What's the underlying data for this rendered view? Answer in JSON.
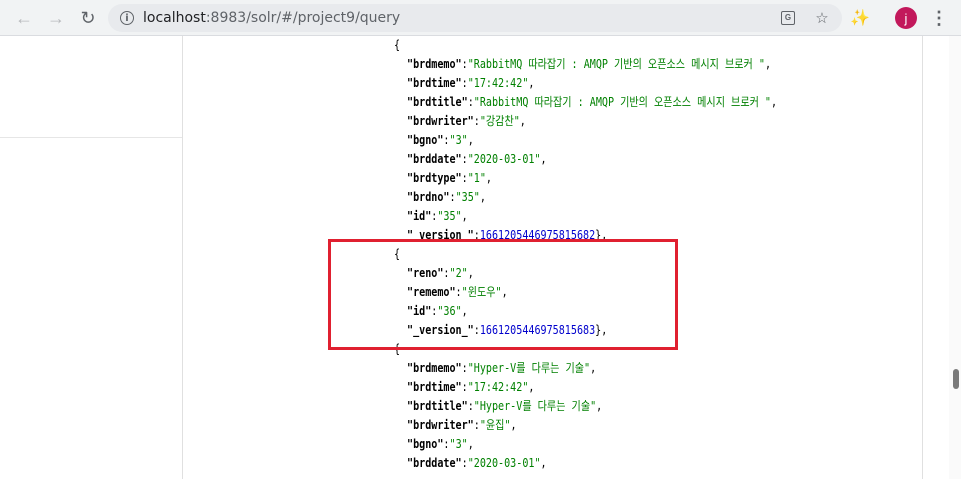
{
  "browser": {
    "url_host": "localhost",
    "url_rest": ":8983/solr/#/project9/query",
    "avatar_letter": "j"
  },
  "records": [
    {
      "type": "brace",
      "text": "{"
    },
    {
      "type": "kv",
      "key": "\"brdmemo\"",
      "value": "\"RabbitMQ 따라잡기 : AMQP 기반의 오픈소스 메시지 브로커 \"",
      "vtype": "s",
      "tail": ","
    },
    {
      "type": "kv",
      "key": "\"brdtime\"",
      "value": "\"17:42:42\"",
      "vtype": "s",
      "tail": ","
    },
    {
      "type": "kv",
      "key": "\"brdtitle\"",
      "value": "\"RabbitMQ 따라잡기 : AMQP 기반의 오픈소스 메시지 브로커 \"",
      "vtype": "s",
      "tail": ","
    },
    {
      "type": "kv",
      "key": "\"brdwriter\"",
      "value": "\"강감찬\"",
      "vtype": "s",
      "tail": ","
    },
    {
      "type": "kv",
      "key": "\"bgno\"",
      "value": "\"3\"",
      "vtype": "s",
      "tail": ","
    },
    {
      "type": "kv",
      "key": "\"brddate\"",
      "value": "\"2020-03-01\"",
      "vtype": "s",
      "tail": ","
    },
    {
      "type": "kv",
      "key": "\"brdtype\"",
      "value": "\"1\"",
      "vtype": "s",
      "tail": ","
    },
    {
      "type": "kv",
      "key": "\"brdno\"",
      "value": "\"35\"",
      "vtype": "s",
      "tail": ","
    },
    {
      "type": "kv",
      "key": "\"id\"",
      "value": "\"35\"",
      "vtype": "s",
      "tail": ","
    },
    {
      "type": "kv",
      "key": "\"_version_\"",
      "value": "1661205446975815682",
      "vtype": "n",
      "tail": "},"
    },
    {
      "type": "brace",
      "text": "{"
    },
    {
      "type": "kv",
      "key": "\"reno\"",
      "value": "\"2\"",
      "vtype": "s",
      "tail": ","
    },
    {
      "type": "kv",
      "key": "\"rememo\"",
      "value": "\"윈도우\"",
      "vtype": "s",
      "tail": ","
    },
    {
      "type": "kv",
      "key": "\"id\"",
      "value": "\"36\"",
      "vtype": "s",
      "tail": ","
    },
    {
      "type": "kv",
      "key": "\"_version_\"",
      "value": "1661205446975815683",
      "vtype": "n",
      "tail": "},"
    },
    {
      "type": "brace",
      "text": "{"
    },
    {
      "type": "kv",
      "key": "\"brdmemo\"",
      "value": "\"Hyper-V를 다루는 기술\"",
      "vtype": "s",
      "tail": ","
    },
    {
      "type": "kv",
      "key": "\"brdtime\"",
      "value": "\"17:42:42\"",
      "vtype": "s",
      "tail": ","
    },
    {
      "type": "kv",
      "key": "\"brdtitle\"",
      "value": "\"Hyper-V를 다루는 기술\"",
      "vtype": "s",
      "tail": ","
    },
    {
      "type": "kv",
      "key": "\"brdwriter\"",
      "value": "\"윤집\"",
      "vtype": "s",
      "tail": ","
    },
    {
      "type": "kv",
      "key": "\"bgno\"",
      "value": "\"3\"",
      "vtype": "s",
      "tail": ","
    },
    {
      "type": "kv",
      "key": "\"brddate\"",
      "value": "\"2020-03-01\"",
      "vtype": "s",
      "tail": ","
    }
  ]
}
